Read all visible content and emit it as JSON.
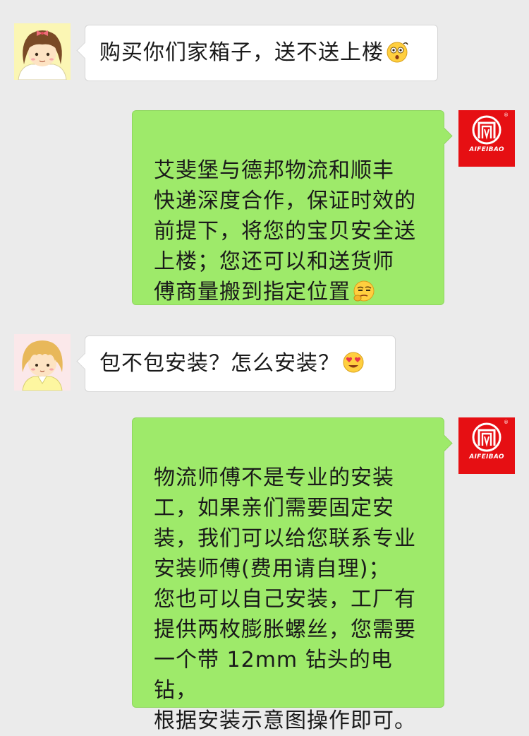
{
  "conversation": {
    "messages": [
      {
        "sender": "customer",
        "avatar": "girl-with-bow-avatar",
        "text": "购买你们家箱子，送不送上楼",
        "emoji": "surprised-emoji"
      },
      {
        "sender": "shop",
        "avatar": "aifeibao-logo",
        "text": "艾斐堡与德邦物流和顺丰\n快递深度合作，保证时效的\n前提下，将您的宝贝安全送\n上楼；您还可以和送货师\n傅商量搬到指定位置",
        "emoji": "thinking-emoji"
      },
      {
        "sender": "customer",
        "avatar": "blonde-girl-avatar",
        "text": "包不包安装？怎么安装？",
        "emoji": "heart-eyes-emoji"
      },
      {
        "sender": "shop",
        "avatar": "aifeibao-logo",
        "text": "物流师傅不是专业的安装\n工，如果亲们需要固定安\n装，我们可以给您联系专业\n安装师傅(费用请自理)；\n您也可以自己安装，工厂有\n提供两枚膨胀螺丝，您需要\n一个带 12mm 钻头的电钻，\n根据安装示意图操作即可。",
        "emoji": ""
      }
    ]
  },
  "brand": {
    "name": "AIFEIBAO",
    "registered_mark": "®",
    "color": "#e60f13"
  },
  "colors": {
    "background": "#ebebeb",
    "incoming_bubble": "#ffffff",
    "outgoing_bubble": "#9eea6a"
  }
}
